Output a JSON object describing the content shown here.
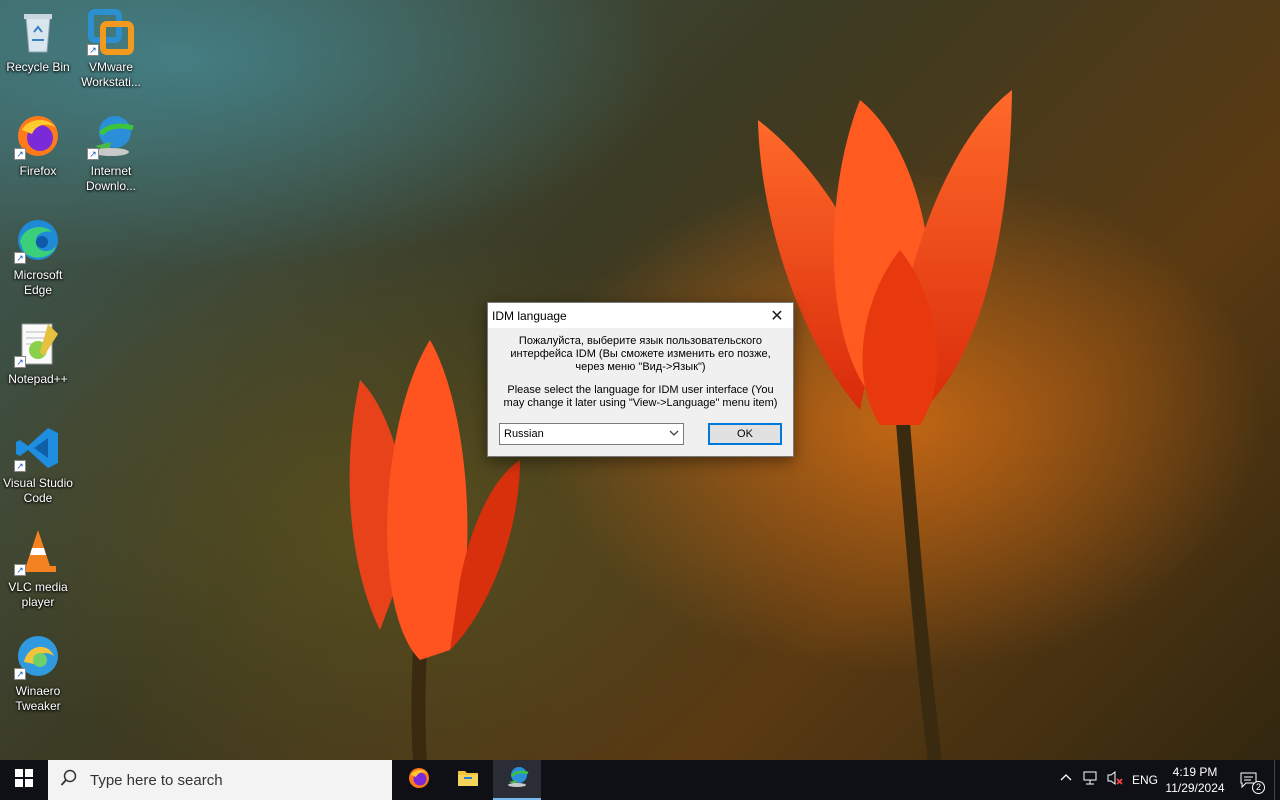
{
  "desktop": {
    "icons": [
      {
        "label": "Recycle Bin",
        "icon": "recycle-bin-icon"
      },
      {
        "label": "VMware Workstati...",
        "icon": "vmware-icon"
      },
      {
        "label": "Firefox",
        "icon": "firefox-icon"
      },
      {
        "label": "Internet Downlo...",
        "icon": "idm-icon"
      },
      {
        "label": "Microsoft Edge",
        "icon": "edge-icon"
      },
      {
        "label": "Notepad++",
        "icon": "notepadpp-icon"
      },
      {
        "label": "Visual Studio Code",
        "icon": "vscode-icon"
      },
      {
        "label": "VLC media player",
        "icon": "vlc-icon"
      },
      {
        "label": "Winaero Tweaker",
        "icon": "winaero-icon"
      }
    ]
  },
  "dialog": {
    "title": "IDM language",
    "close_glyph": "✕",
    "message_ru": "Пожалуйста, выберите язык пользовательского интерфейса IDM (Вы сможете изменить его позже, через меню \"Вид->Язык\")",
    "message_en": "Please select the language for IDM user interface (You may change it later using \"View->Language\" menu item)",
    "language_selected": "Russian",
    "ok_label": "OK"
  },
  "taskbar": {
    "search_placeholder": "Type here to search",
    "apps": [
      "firefox-icon",
      "file-explorer-icon",
      "idm-icon"
    ],
    "tray": {
      "language": "ENG",
      "time": "4:19 PM",
      "date": "11/29/2024",
      "notification_count": "2"
    }
  },
  "colors": {
    "accent": "#0078d7",
    "taskbar": "#0e1016",
    "tulip": "#ff4a1c"
  }
}
